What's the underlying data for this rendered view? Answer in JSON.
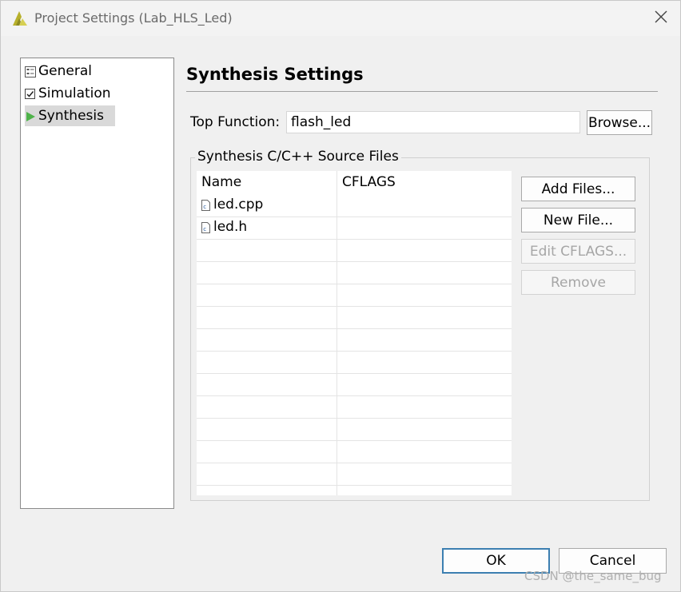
{
  "window": {
    "title": "Project Settings (Lab_HLS_Led)"
  },
  "nav": {
    "items": [
      {
        "label": "General",
        "icon": "general-settings-icon"
      },
      {
        "label": "Simulation",
        "icon": "checkbox-icon"
      },
      {
        "label": "Synthesis",
        "icon": "play-icon",
        "selected": true
      }
    ]
  },
  "main": {
    "heading": "Synthesis Settings",
    "top_function_label": "Top Function:",
    "top_function_value": "flash_led",
    "browse_label": "Browse...",
    "group_title": "Synthesis C/C++ Source Files",
    "table": {
      "headers": [
        "Name",
        "CFLAGS"
      ],
      "rows": [
        {
          "name": "led.cpp",
          "cflags": ""
        },
        {
          "name": "led.h",
          "cflags": ""
        }
      ]
    },
    "buttons": {
      "add_files": "Add Files...",
      "new_file": "New File...",
      "edit_cflags": "Edit CFLAGS...",
      "remove": "Remove"
    }
  },
  "footer": {
    "ok": "OK",
    "cancel": "Cancel"
  },
  "watermark": "CSDN @the_same_bug",
  "colors": {
    "accent_border": "#3c7fb1",
    "selected_bg": "#d9d9d9"
  }
}
